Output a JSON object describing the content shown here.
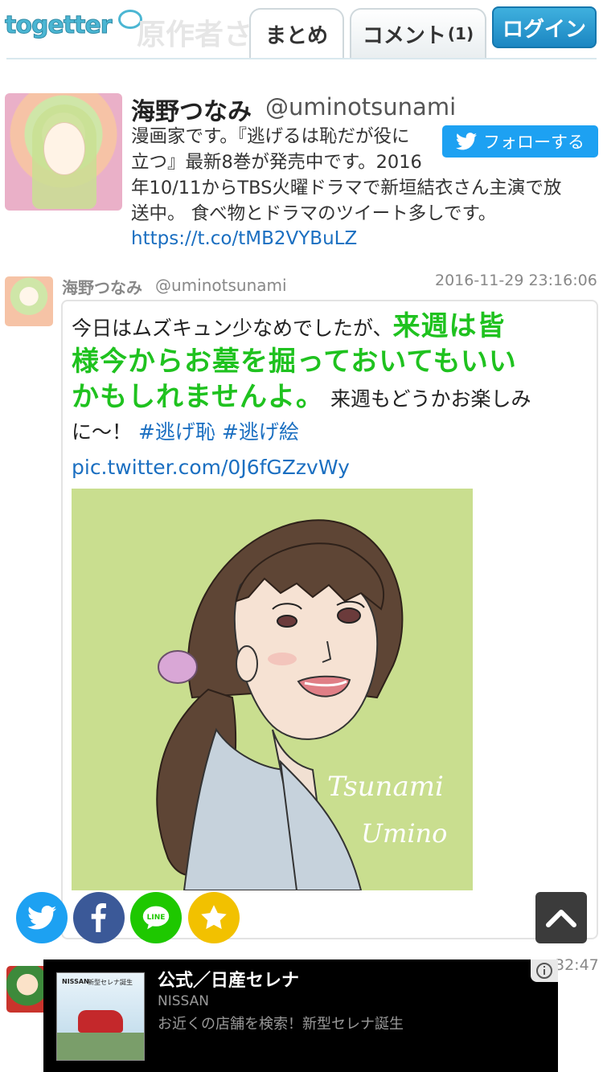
{
  "header": {
    "logo_text": "togetter",
    "ghost_title": "原作者さん",
    "tabs": [
      {
        "label": "まとめ",
        "active": true
      },
      {
        "label": "コメント",
        "count": "(1)",
        "active": false
      }
    ],
    "login_label": "ログイン"
  },
  "profile": {
    "name": "海野つなみ",
    "handle": "@uminotsunami",
    "bio_lines": [
      "漫画家です。『逃げるは恥だが役に",
      "立つ』最新8巻が発売中です。2016",
      "年10/11からTBS火曜ドラマで新垣結衣さん主演で放",
      "送中。 食べ物とドラマのツイート多しです。"
    ],
    "link": "https://t.co/tMB2VYBuLZ",
    "follow_label": "フォローする"
  },
  "tweet": {
    "name": "海野つなみ",
    "handle": "@uminotsunami",
    "timestamp": "2016-11-29 23:16:06",
    "text_plain_1": "今日はムズキュン少なめでしたが、",
    "text_highlight_1": "来週は皆",
    "text_highlight_2": "様今からお墓を掘っておいてもいい",
    "text_highlight_3": "かもしれませんよ。",
    "text_plain_2": "来週もどうかお楽しみ",
    "text_plain_3": "に〜！",
    "hashtags": [
      "#逃げ恥",
      "#逃げ絵"
    ],
    "pic_link": "pic.twitter.com/0J6fGZzvWy",
    "image_signature": "Tsunami Umino",
    "colors": {
      "highlight": "#1fc21f",
      "link": "#1b6fc1",
      "image_bg": "#c9de8f"
    }
  },
  "share": {
    "buttons": [
      "twitter-icon",
      "facebook-icon",
      "line-icon",
      "star-icon"
    ],
    "line_label": "LINE"
  },
  "next_tweet": {
    "timestamp_fragment": "32:47"
  },
  "ad": {
    "title": "公式／日産セレナ",
    "advertiser": "NISSAN",
    "description": "お近くの店舗を検索！新型セレナ誕生",
    "thumb_brand": "NISSAN",
    "thumb_caption": "新型セレナ誕生"
  }
}
